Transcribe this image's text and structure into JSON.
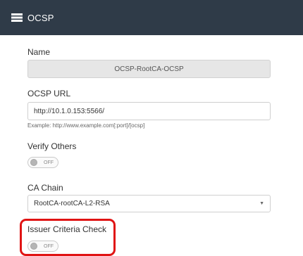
{
  "header": {
    "title": "OCSP",
    "icon": "menu-icon"
  },
  "name": {
    "label": "Name",
    "value": "OCSP-RootCA-OCSP"
  },
  "ocsp_url": {
    "label": "OCSP URL",
    "value": "http://10.1.0.153:5566/",
    "hint": "Example: http://www.example.com[:port]/[ocsp]"
  },
  "verify_others": {
    "label": "Verify Others",
    "state": "OFF"
  },
  "ca_chain": {
    "label": "CA Chain",
    "value": "RootCA-rootCA-L2-RSA",
    "caret": "▼"
  },
  "issuer_criteria": {
    "label": "Issuer Criteria Check",
    "state": "OFF"
  },
  "colors": {
    "header_bg": "#2f3b48",
    "highlight": "#e01414"
  }
}
